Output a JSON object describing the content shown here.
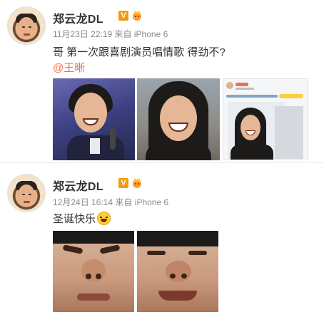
{
  "posts": [
    {
      "author": "郑云龙DL",
      "verified_badge": "V",
      "date": "11月23日",
      "time": "22:19",
      "via": "来自",
      "device": "iPhone 6",
      "text": "哥 第一次跟喜剧演员唱情歌 得劲不?",
      "mention": "@王晰",
      "photos": [
        {
          "name": "singing-photo"
        },
        {
          "name": "laughing-photo"
        },
        {
          "name": "weibo-screenshot-photo"
        }
      ]
    },
    {
      "author": "郑云龙DL",
      "verified_badge": "V",
      "date": "12月24日",
      "time": "16:14",
      "via": "来自",
      "device": "iPhone 6",
      "text": "圣诞快乐",
      "photos": [
        {
          "name": "funny-face-photo-1"
        },
        {
          "name": "funny-face-photo-2"
        }
      ]
    }
  ],
  "colors": {
    "mention": "#eb7350",
    "meta": "#8a8a8a",
    "badge": "#f39a13"
  }
}
